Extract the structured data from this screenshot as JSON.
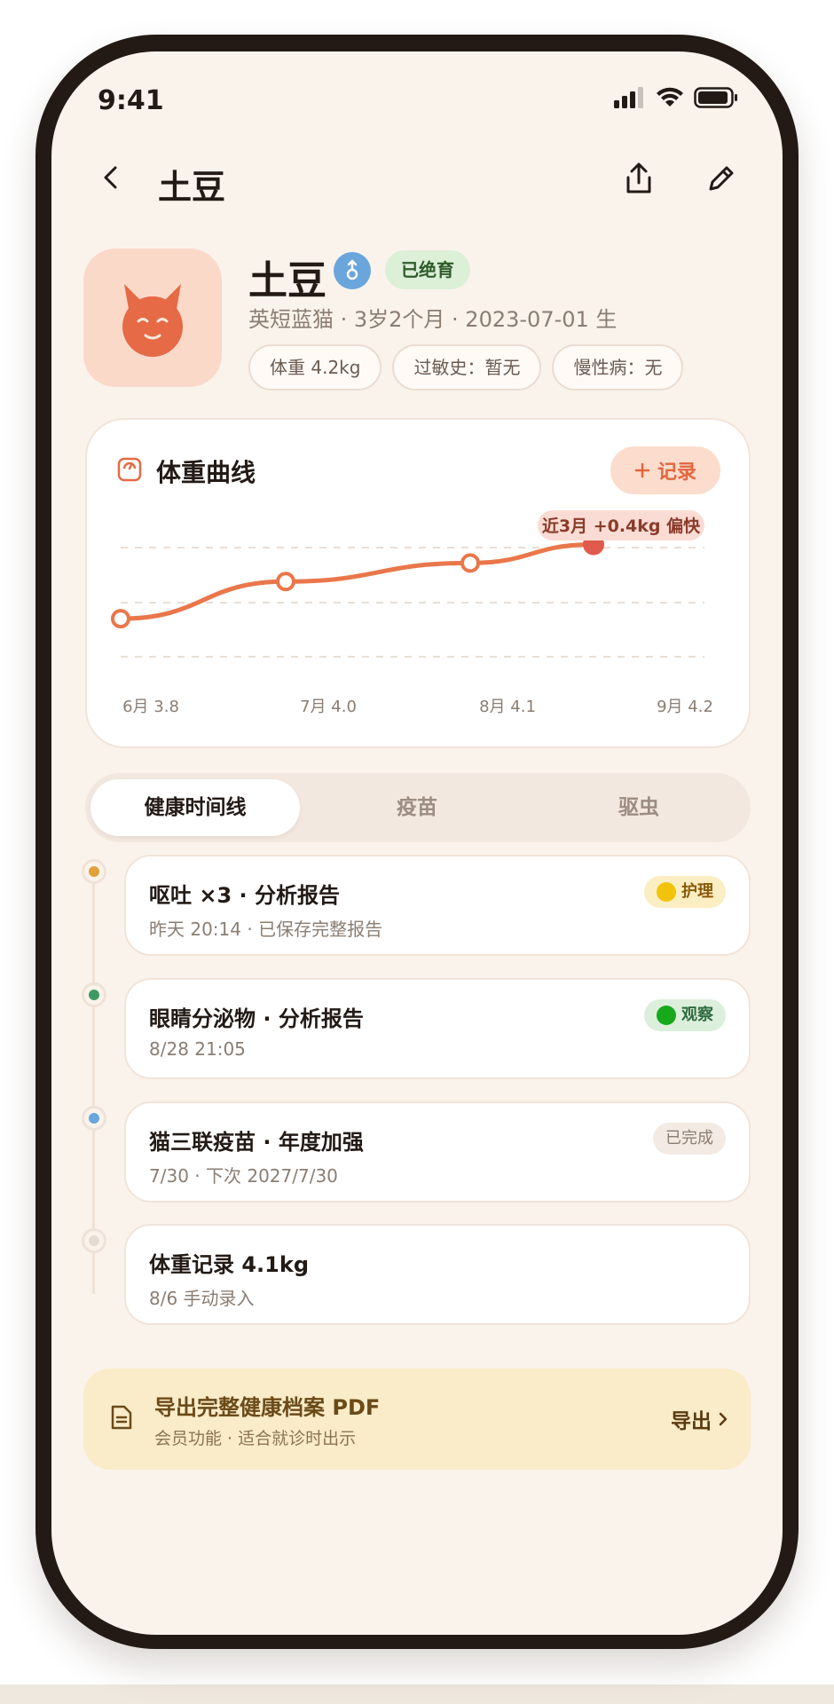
{
  "status_bar": {
    "time": "9:41"
  },
  "nav": {
    "title": "土豆"
  },
  "pet": {
    "name": "土豆",
    "neuter_badge": "已绝育",
    "meta": "英短蓝猫 · 3岁2个月 · 2023-07-01 生",
    "chips": [
      "体重 4.2kg",
      "过敏史：暂无",
      "慢性病：无"
    ]
  },
  "weight_card": {
    "title": "体重曲线",
    "record_label": "记录",
    "annotation": "近3月 +0.4kg 偏快"
  },
  "chart_data": {
    "type": "line",
    "categories": [
      "6月",
      "7月",
      "8月",
      "9月"
    ],
    "tick_labels": [
      "6月 3.8",
      "7月 4.0",
      "8月 4.1",
      "9月 4.2"
    ],
    "values": [
      3.8,
      4.0,
      4.1,
      4.2
    ],
    "ylim": [
      3.7,
      4.25
    ],
    "grid": true,
    "colors": {
      "line": "#e9774a",
      "last_point": "#e05a4e"
    }
  },
  "tabs": [
    "健康时间线",
    "疫苗",
    "驱虫"
  ],
  "timeline": [
    {
      "title": "呕吐 ×3 · 分析报告",
      "subtitle": "昨天 20:14 · 已保存完整报告",
      "badge": "护理",
      "dot_color": "#e0a23a"
    },
    {
      "title": "眼睛分泌物 · 分析报告",
      "subtitle": "8/28 21:05",
      "badge": "观察",
      "dot_color": "#3f9a62"
    },
    {
      "title": "猫三联疫苗 · 年度加强",
      "subtitle": "7/30 · 下次 2027/7/30",
      "badge": "已完成",
      "dot_color": "#6aa5dc"
    },
    {
      "title": "体重记录 4.1kg",
      "subtitle": "8/6 手动录入",
      "badge": "",
      "dot_color": "#e6dbd2"
    }
  ],
  "export": {
    "title": "导出完整健康档案 PDF",
    "subtitle": "会员功能 · 适合就诊时出示",
    "button": "导出"
  }
}
